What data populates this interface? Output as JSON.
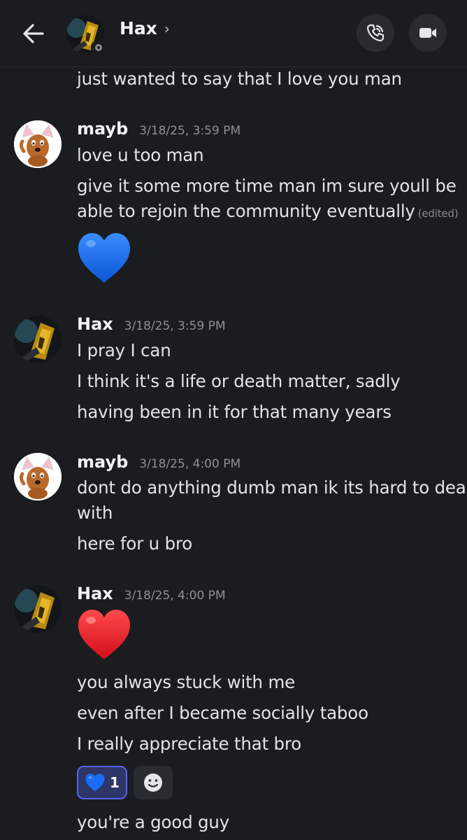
{
  "header": {
    "name": "Hax",
    "chevron": "›",
    "back_icon": "arrow-left-icon",
    "call_icon": "phone-icon",
    "video_icon": "video-camera-icon",
    "status": "offline"
  },
  "messages": [
    {
      "text": "just wanted to say that I love you man"
    },
    {
      "author": "mayb",
      "timestamp": "3/18/25, 3:59 PM",
      "lines": [
        "love u too man",
        "give it some more time man im sure youll be",
        "able to rejoin the community eventually"
      ],
      "edited": "(edited)",
      "emoji": "blue-heart",
      "emoji_color": "#1a6cf5"
    },
    {
      "author": "Hax",
      "timestamp": "3/18/25, 3:59 PM",
      "lines": [
        "I pray I can",
        "I think it's a life or death matter, sadly",
        "having been in it for that many years"
      ]
    },
    {
      "author": "mayb",
      "timestamp": "3/18/25, 4:00 PM",
      "lines": [
        "dont do anything dumb man ik its hard to deal",
        "with",
        "here for u bro"
      ]
    },
    {
      "author": "Hax",
      "timestamp": "3/18/25, 4:00 PM",
      "emoji": "red-heart",
      "emoji_color": "#e8202a",
      "lines": [
        "you always stuck with me",
        "even after I became socially taboo",
        "I really appreciate that bro",
        "you're a good guy"
      ],
      "reaction": {
        "emoji": "blue-heart",
        "count": "1"
      }
    }
  ],
  "colors": {
    "background": "#1b1c20",
    "text": "#e3e4e8",
    "muted": "#8f9097",
    "reaction_bg": "#2e3567",
    "reaction_border": "#5865f2"
  }
}
